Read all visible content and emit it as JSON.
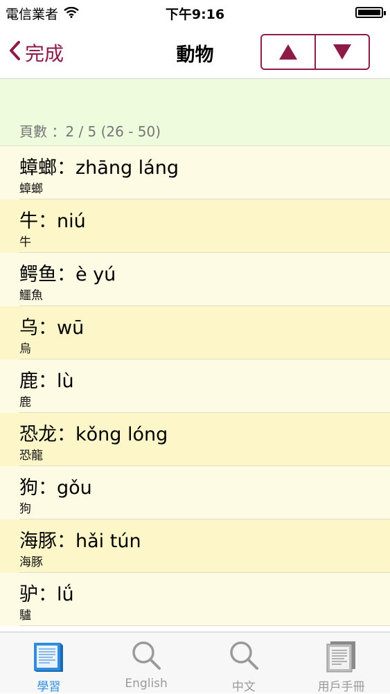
{
  "status_bar": {
    "carrier": "電信業者",
    "time": "下午9:16"
  },
  "nav": {
    "back_label": "完成",
    "title": "動物",
    "prev_symbol": "▲",
    "next_symbol": "▼"
  },
  "colors": {
    "accent": "#8d1b47",
    "tab_active": "#2f8de0",
    "header_bg": "#eefbdc",
    "row_light": "#fefbe4",
    "row_dark": "#fcf6c9"
  },
  "page_info": "頁數 ：2 / 5 (26 - 50)",
  "entries": [
    {
      "main": "蟑螂：zhāng  láng",
      "sub": "蟑螂"
    },
    {
      "main": "牛：niú",
      "sub": "牛"
    },
    {
      "main": "鳄鱼：è  yú",
      "sub": "鱷魚"
    },
    {
      "main": "乌：wū",
      "sub": "烏"
    },
    {
      "main": "鹿：lù",
      "sub": "鹿"
    },
    {
      "main": "恐龙：kǒng  lóng",
      "sub": "恐龍"
    },
    {
      "main": "狗：gǒu",
      "sub": "狗"
    },
    {
      "main": "海豚：hǎi  tún",
      "sub": "海豚"
    },
    {
      "main": "驴：lǘ",
      "sub": "驢"
    }
  ],
  "tabs": [
    {
      "label": "學習",
      "icon": "book-icon",
      "active": true
    },
    {
      "label": "English",
      "icon": "search-icon"
    },
    {
      "label": "中文",
      "icon": "search-icon"
    },
    {
      "label": "用戶手冊",
      "icon": "manual-icon"
    }
  ]
}
